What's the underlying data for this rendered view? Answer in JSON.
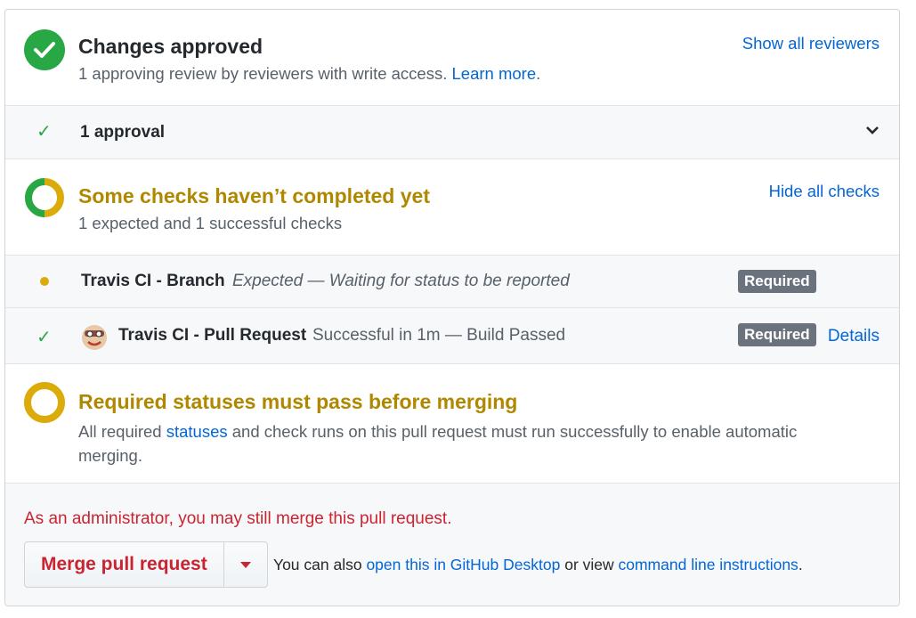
{
  "approval": {
    "title": "Changes approved",
    "subtitle": "1 approving review by reviewers with write access.",
    "learn_more": "Learn more",
    "learn_more_suffix": ".",
    "show_reviewers": "Show all reviewers",
    "count_label": "1 approval"
  },
  "checks": {
    "title": "Some checks haven’t completed yet",
    "subtitle": "1 expected and 1 successful checks",
    "hide_all": "Hide all checks",
    "items": [
      {
        "name": "Travis CI - Branch",
        "status": "Expected — Waiting for status to be reported",
        "badge": "Required"
      },
      {
        "name": "Travis CI - Pull Request",
        "status": "Successful in 1m — Build Passed",
        "badge": "Required",
        "details": "Details"
      }
    ]
  },
  "required": {
    "title": "Required statuses must pass before merging",
    "text_before": "All required ",
    "statuses_link": "statuses",
    "text_after": " and check runs on this pull request must run successfully to enable automatic merging."
  },
  "merge": {
    "admin_notice": "As an administrator, you may still merge this pull request.",
    "button_label": "Merge pull request",
    "alt_prefix": "You can also ",
    "desktop_link": "open this in GitHub Desktop",
    "alt_middle": " or view ",
    "cli_link": "command line instructions",
    "alt_suffix": "."
  },
  "colors": {
    "success": "#28a745",
    "pending": "#dbab09",
    "pending_text": "#b08800",
    "danger": "#cb2431",
    "link": "#0366d6"
  },
  "icons": [
    "check-circle-icon",
    "check-icon",
    "chevron-down-icon",
    "partial-ring-icon",
    "dot-icon",
    "travis-avatar-icon",
    "ring-icon",
    "caret-down-icon"
  ]
}
